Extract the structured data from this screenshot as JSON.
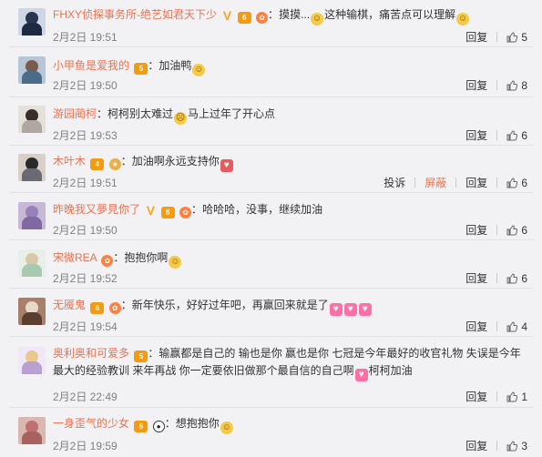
{
  "labels": {
    "reply": "回复",
    "report": "投诉",
    "block": "屏蔽"
  },
  "comments": [
    {
      "user": "FHXY侦探事务所-绝艺如君天下少",
      "text_before": "摸摸...",
      "text_middle": "这种输棋，痛苦点可以理解",
      "time": "2月2日 19:51",
      "likes": "5"
    },
    {
      "user": "小甲鱼是爱我的",
      "text_before": "加油鸭",
      "time": "2月2日 19:50",
      "likes": "8"
    },
    {
      "user": "游园蔺柯",
      "text_before": "柯柯别太难过",
      "text_middle": "马上过年了开心点",
      "time": "2月2日 19:53",
      "likes": "6"
    },
    {
      "user": "木叶木",
      "text_before": "加油啊永远支持你",
      "time": "2月2日 19:51",
      "likes": "6"
    },
    {
      "user": "昨晚我又夢見你了",
      "text_before": "哈哈哈，没事，继续加油",
      "time": "2月2日 19:50",
      "likes": "6"
    },
    {
      "user": "宋微REA",
      "text_before": "抱抱你啊",
      "time": "2月2日 19:52",
      "likes": "6"
    },
    {
      "user": "无魇鬼",
      "text_before": "新年快乐，好好过年吧，再赢回来就是了",
      "time": "2月2日 19:54",
      "likes": "4"
    },
    {
      "user": "奥利奥和可爱多",
      "text_before": "输赢都是自己的 输也是你 赢也是你 七冠是今年最好的收官礼物 失误是今年最大的经验教训 来年再战 你一定要依旧做那个最自信的自己啊",
      "text_middle": "柯柯加油",
      "time": "2月2日 22:49",
      "likes": "1"
    },
    {
      "user": "一身歪气的少女",
      "text_before": "想抱抱你",
      "time": "2月2日 19:59",
      "likes": "3"
    }
  ],
  "colors": {
    "username": "#eb7350",
    "background": "#f2f2f5",
    "time": "#808080"
  }
}
